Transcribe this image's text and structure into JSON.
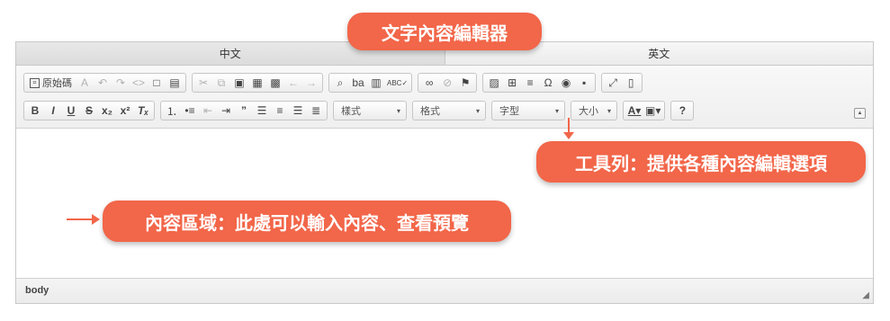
{
  "annotations": {
    "title": "文字內容編輯器",
    "toolbar_note": "工具列：提供各種內容編輯選項",
    "content_note": "內容區域：此處可以輸入內容、查看預覽"
  },
  "tabs": [
    {
      "label": "中文",
      "active": true
    },
    {
      "label": "英文",
      "active": false
    }
  ],
  "toolbar": {
    "row1": {
      "source_label": "原始碼",
      "spellcheck_icon": "ABC✓"
    },
    "row2": {
      "styles_label": "樣式",
      "format_label": "格式",
      "font_label": "字型",
      "size_label": "大小",
      "help_label": "?"
    }
  },
  "statusbar": {
    "path": "body"
  },
  "colors": {
    "accent": "#f26649",
    "toolbar_bg": "#f0f0f0",
    "border": "#c9c9c9"
  }
}
